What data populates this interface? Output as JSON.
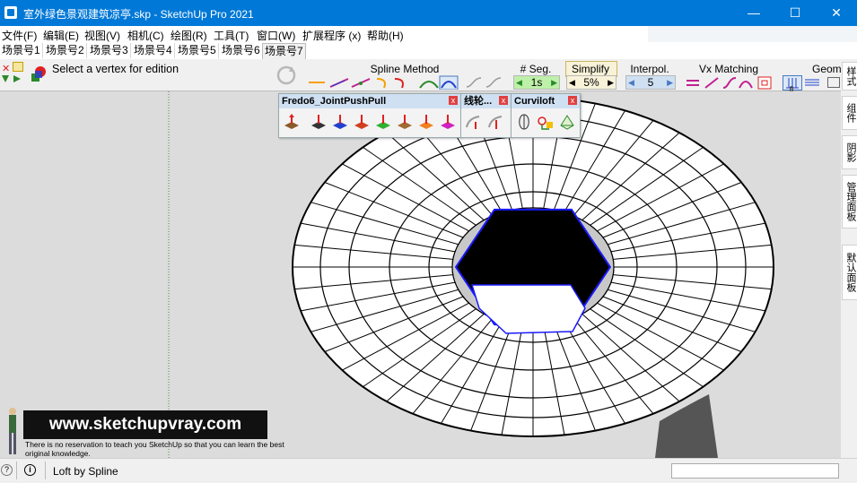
{
  "window": {
    "title": "室外绿色景观建筑凉亭.skp - SketchUp Pro 2021",
    "minimize": "—",
    "maximize": "☐",
    "close": "✕"
  },
  "menu": [
    "文件(F)",
    "编辑(E)",
    "视图(V)",
    "相机(C)",
    "绘图(R)",
    "工具(T)",
    "窗口(W)",
    "扩展程序 (x)",
    "帮助(H)"
  ],
  "scenes": {
    "tabs": [
      "场景号1",
      "场景号2",
      "场景号3",
      "场景号4",
      "场景号5",
      "场景号6",
      "场景号7"
    ],
    "active_index": 6
  },
  "toolbar": {
    "prompt": "Select a vertex for edition",
    "spline_method": "Spline Method",
    "seg": {
      "label": "# Seg.",
      "value": "1s"
    },
    "simplify": {
      "label": "Simplify",
      "value": "5%"
    },
    "interpol": {
      "label": "Interpol.",
      "value": "5"
    },
    "vx_matching": "Vx Matching",
    "geom": "Geom"
  },
  "panels": {
    "fredo": {
      "title": "Fredo6_JointPushPull"
    },
    "xianjiao": {
      "title": "线轮..."
    },
    "curviloft": {
      "title": "Curviloft"
    },
    "close_glyph": "x"
  },
  "right_tabs": [
    "样式",
    "组件",
    "阴影",
    "管理面板",
    "默认面板"
  ],
  "status": {
    "text": "Loft by Spline"
  },
  "watermark": {
    "url": "www.sketchupvray.com",
    "sub": "There is no reservation to teach you SketchUp so that you can learn the best original knowledge."
  },
  "colors": {
    "titlebar": "#0078d7",
    "selection": "#1a1aff",
    "panel_header": "#cfe0f3"
  },
  "model": {
    "outer_segments": 48,
    "hole_vertices": 6
  }
}
